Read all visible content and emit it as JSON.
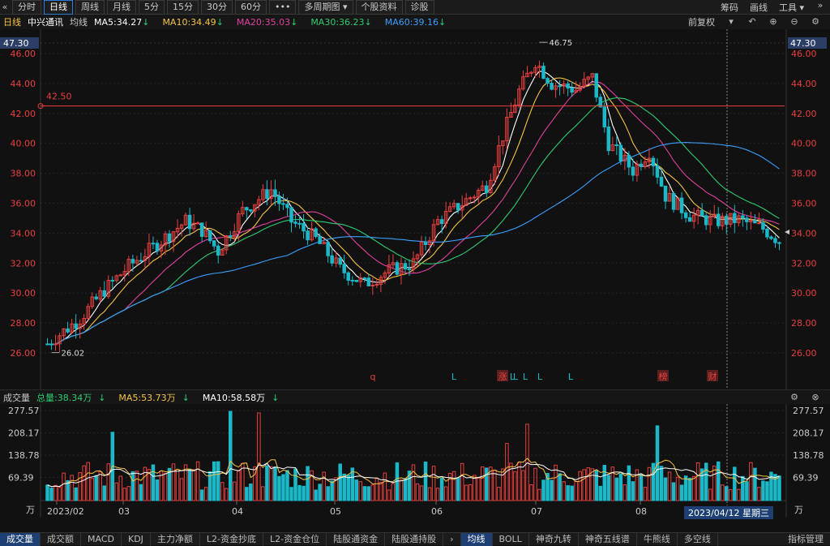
{
  "toolbar": {
    "back_icon": "double-chevron-left",
    "periods": [
      "分时",
      "日线",
      "周线",
      "月线",
      "5分",
      "15分",
      "30分",
      "60分"
    ],
    "active_period": "日线",
    "more": "•••",
    "multi_period": "多周期图",
    "profile": "个股资料",
    "diagnose": "诊股",
    "right": [
      "筹码",
      "画线",
      "工具"
    ],
    "window_icons": [
      "double-chevron-right"
    ]
  },
  "main_header": {
    "period": "日线",
    "stock": "中兴通讯",
    "ma_label": "均线",
    "mas": [
      {
        "text": "MA5:34.27",
        "arrow": "↓",
        "color": "#ffffff"
      },
      {
        "text": "MA10:34.49",
        "arrow": "↓",
        "color": "#f6c343"
      },
      {
        "text": "MA20:35.03",
        "arrow": "↓",
        "color": "#e040a0"
      },
      {
        "text": "MA30:36.23",
        "arrow": "↓",
        "color": "#2ecc71"
      },
      {
        "text": "MA60:39.16",
        "arrow": "↓",
        "color": "#3aa0ff"
      }
    ],
    "adjust": "前复权"
  },
  "price_axis": {
    "labels": [
      "46.00",
      "44.00",
      "42.00",
      "40.00",
      "38.00",
      "36.00",
      "34.00",
      "32.00",
      "30.00",
      "28.00",
      "26.00"
    ],
    "top_tag": "47.30"
  },
  "annotations": {
    "high": "46.75",
    "low": "26.02",
    "hline": "42.50",
    "markers": [
      "q",
      "L",
      "涨",
      "L",
      "L",
      "L",
      "L",
      "L",
      "L",
      "榜",
      "财"
    ]
  },
  "volume_header": {
    "title": "成交量",
    "total": "总量:38.34万",
    "total_arrow": "↓",
    "ma5": "MA5:53.73万",
    "ma5_arrow": "↓",
    "ma10": "MA10:58.58万",
    "ma10_arrow": "↓"
  },
  "volume_axis": {
    "labels": [
      "277.57",
      "208.17",
      "138.78",
      "69.39"
    ],
    "unit": "万"
  },
  "date_axis": {
    "labels": [
      "2023/02",
      "03",
      "04",
      "05",
      "06",
      "07",
      "08"
    ],
    "cursor_date": "2023/04/12 星期三"
  },
  "bottom_tabs": [
    "成交量",
    "成交额",
    "MACD",
    "KDJ",
    "主力净额",
    "L2-资金抄底",
    "L2-资金仓位",
    "陆股通资金",
    "陆股通持股"
  ],
  "bottom_tabs_active": "成交量",
  "bottom_tabs_right": [
    "均线",
    "BOLL",
    "神奇九转",
    "神奇五线谱",
    "牛熊线",
    "多空线"
  ],
  "bottom_tabs_right_active": "均线",
  "bottom_tabs_end": "指标管理",
  "colors": {
    "up": "#e8403f",
    "down": "#1bb8c8",
    "bg": "#111111",
    "grid": "#2a2a2a"
  }
}
